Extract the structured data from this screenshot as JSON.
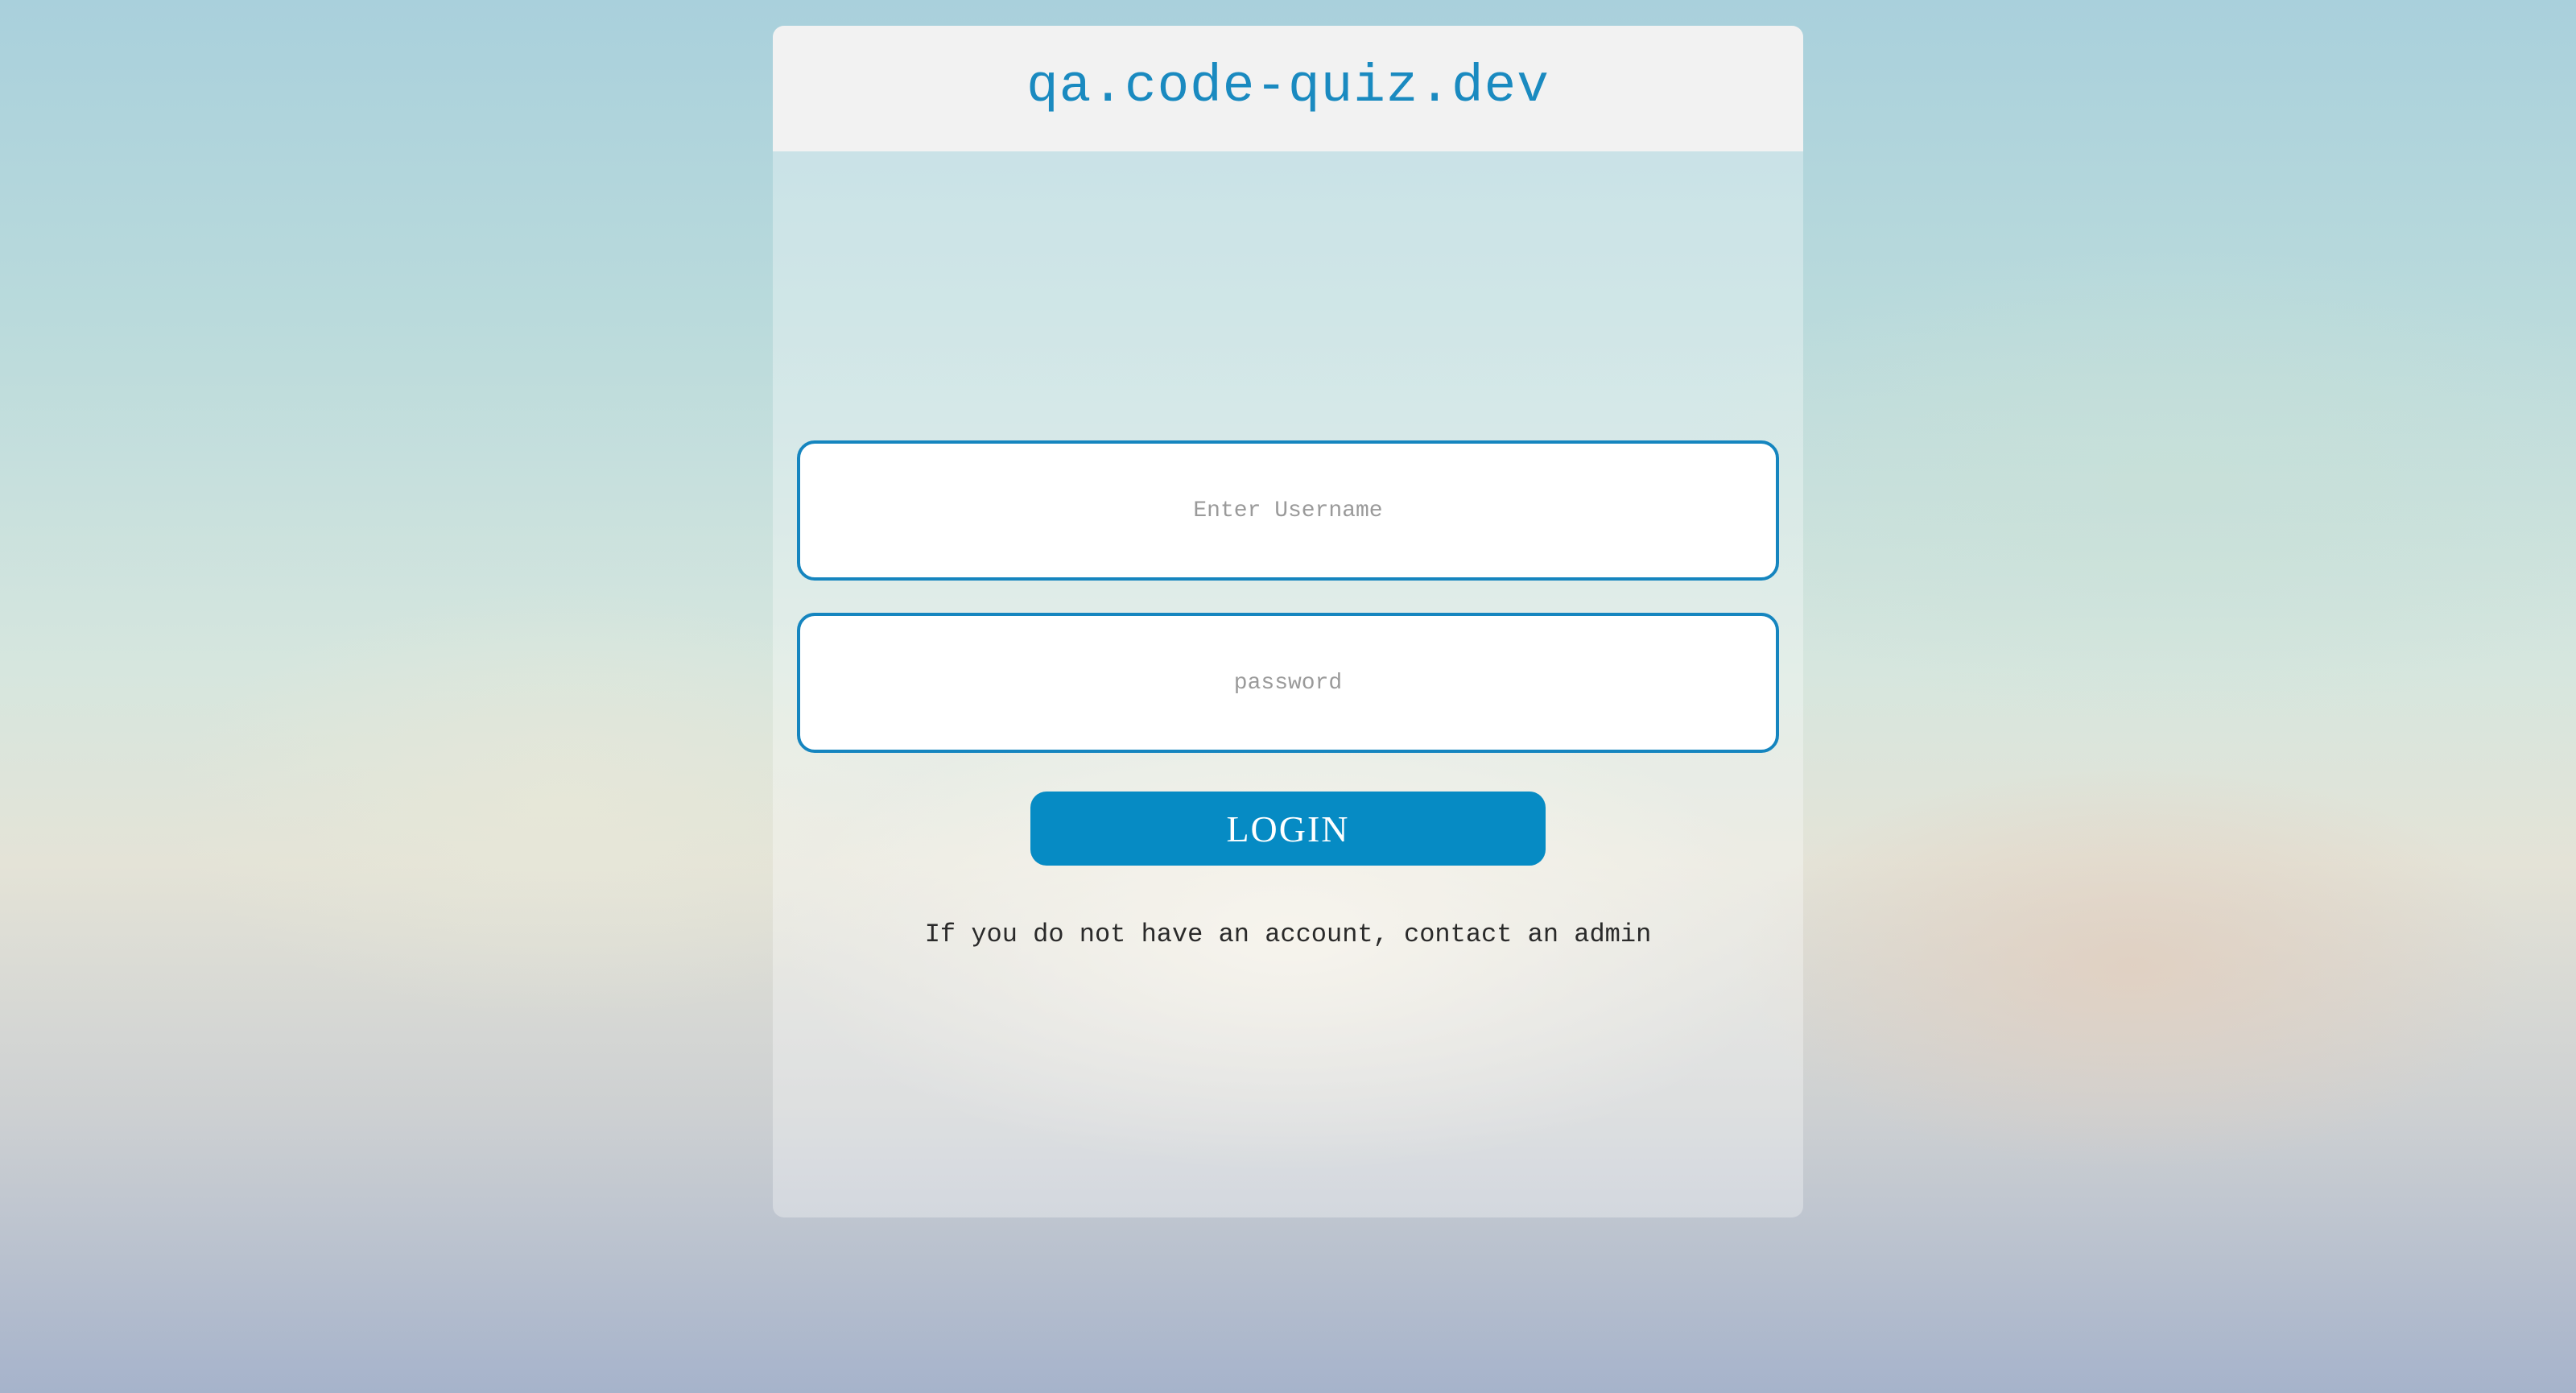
{
  "header": {
    "title": "qa.code-quiz.dev"
  },
  "login_form": {
    "username_placeholder": "Enter Username",
    "password_placeholder": "password",
    "login_label": "LOGIN",
    "help_text": "If you do not have an account, contact an admin"
  },
  "colors": {
    "accent": "#068bc4",
    "input_border": "#1585bf",
    "header_background": "#f2f2f2"
  }
}
